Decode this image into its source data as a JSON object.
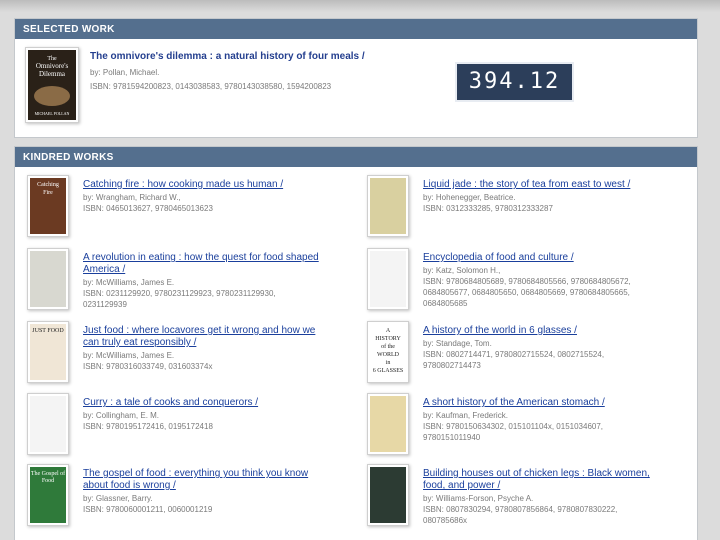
{
  "selected": {
    "header": "SELECTED WORK",
    "title": "The omnivore's dilemma : a natural history of four meals /",
    "author": "by: Pollan, Michael.",
    "isbn": "ISBN: 9781594200823, 0143038583, 9780143038580, 1594200823",
    "cover_text": [
      "The",
      "Omnivore's",
      "Dilemma",
      "MICHAEL POLLAN"
    ]
  },
  "call_number": "394.12",
  "kindred": {
    "header": "KINDRED WORKS",
    "left": [
      {
        "title_lines": [
          "Catching fire : how cooking made us human /"
        ],
        "author": "by: Wrangham, Richard W.,",
        "isbn_lines": [
          "ISBN: 0465013627, 9780465013623"
        ],
        "cover_color": "#6b3a22",
        "cover_text": [
          "Catching",
          "Fire"
        ]
      },
      {
        "title_lines": [
          "A revolution in eating : how the quest for food shaped",
          "America /"
        ],
        "author": "by: McWilliams, James E.",
        "isbn_lines": [
          "ISBN: 0231129920, 9780231129923, 9780231129930,",
          "0231129939"
        ],
        "cover_color": "#d8d8d0",
        "cover_text": []
      },
      {
        "title_lines": [
          "Just food : where locavores get it wrong and how we",
          "can truly eat responsibly /"
        ],
        "author": "by: McWilliams, James E.",
        "isbn_lines": [
          "ISBN: 9780316033749, 031603374x"
        ],
        "cover_color": "#f0e6d6",
        "cover_text": [
          "JUST FOOD"
        ]
      },
      {
        "title_lines": [
          "Curry : a tale of cooks and conquerors /"
        ],
        "author": "by: Collingham, E. M.",
        "isbn_lines": [
          "ISBN: 9780195172416, 0195172418"
        ],
        "cover_color": "",
        "cover_text": []
      },
      {
        "title_lines": [
          "The gospel of food : everything you think you know",
          "about food is wrong /"
        ],
        "author": "by: Glassner, Barry.",
        "isbn_lines": [
          "ISBN: 9780060001211, 0060001219"
        ],
        "cover_color": "#2f7a3a",
        "cover_text": [
          "The Gospel of Food"
        ]
      }
    ],
    "right": [
      {
        "title_lines": [
          "Liquid jade : the story of tea from east to west /"
        ],
        "author": "by: Hohenegger, Beatrice.",
        "isbn_lines": [
          "ISBN: 0312333285, 9780312333287"
        ],
        "cover_color": "#d9d0a0",
        "cover_text": []
      },
      {
        "title_lines": [
          "Encyclopedia of food and culture /"
        ],
        "author": "by: Katz, Solomon H.,",
        "isbn_lines": [
          "ISBN: 9780684805689, 9780684805566, 9780684805672,",
          "0684805677, 0684805650, 0684805669, 9780684805665,",
          "0684805685"
        ],
        "cover_color": "",
        "cover_text": []
      },
      {
        "title_lines": [
          "A history of the world in 6 glasses /"
        ],
        "author": "by: Standage, Tom.",
        "isbn_lines": [
          "ISBN: 0802714471, 9780802715524, 0802715524,",
          "9780802714473"
        ],
        "cover_color": "#ffffff",
        "cover_text": [
          "A",
          "HISTORY",
          "of the",
          "WORLD",
          "in",
          "6 GLASSES"
        ]
      },
      {
        "title_lines": [
          "A short history of the American stomach /"
        ],
        "author": "by: Kaufman, Frederick.",
        "isbn_lines": [
          "ISBN: 9780150634302, 015101104x, 0151034607,",
          "9780151011940"
        ],
        "cover_color": "#e7d8a6",
        "cover_text": []
      },
      {
        "title_lines": [
          "Building houses out of chicken legs : Black women,",
          "food, and power /"
        ],
        "author": "by: Williams-Forson, Psyche A.",
        "isbn_lines": [
          "ISBN: 0807830294, 9780807856864, 9780807830222,",
          "080785686x"
        ],
        "cover_color": "#2c3b33",
        "cover_text": []
      }
    ]
  }
}
